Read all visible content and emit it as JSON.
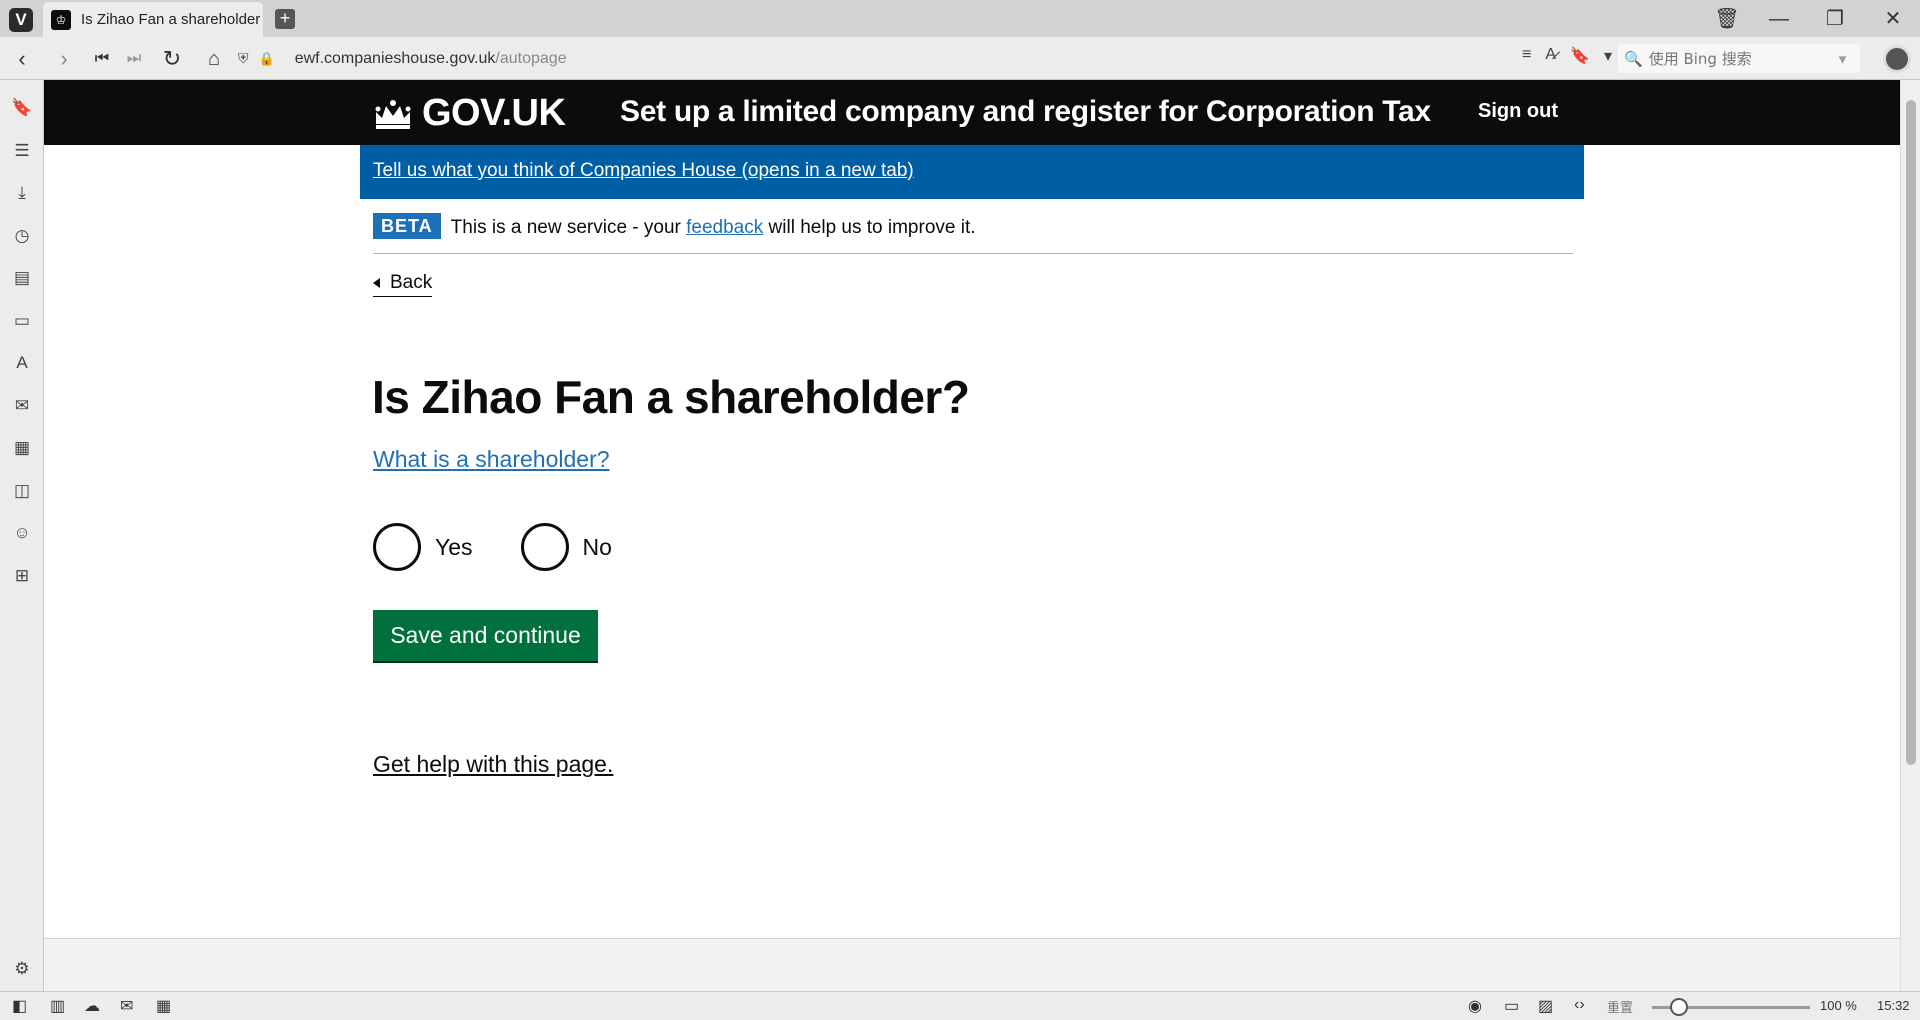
{
  "browser": {
    "tab_title": "Is Zihao Fan a shareholder?",
    "url_host": "ewf.companieshouse.gov.uk",
    "url_path": "/autopage",
    "search_placeholder": "使用 Bing 搜索",
    "zoom_reset_label": "重置",
    "zoom_level": "100 %",
    "clock": "15:32"
  },
  "header": {
    "logo_text": "GOV.UK",
    "service_name": "Set up a limited company and register for Corporation Tax",
    "signout_label": "Sign out"
  },
  "feedback_banner": {
    "link_text": "Tell us what you think of Companies House (opens in a new tab)"
  },
  "phase_banner": {
    "tag": "BETA",
    "text_before": "This is a new service - your ",
    "link_text": "feedback",
    "text_after": " will help us to improve it."
  },
  "back_link": "Back",
  "question": {
    "heading": "Is Zihao Fan a shareholder?",
    "help_link": "What is a shareholder?",
    "options": [
      "Yes",
      "No"
    ]
  },
  "save_button": "Save and continue",
  "get_help_link": "Get help with this page.",
  "colors": {
    "header_bg": "#0b0c0c",
    "banner_blue": "#005ea5",
    "link_blue": "#1d70b8",
    "button_green": "#00703c"
  }
}
